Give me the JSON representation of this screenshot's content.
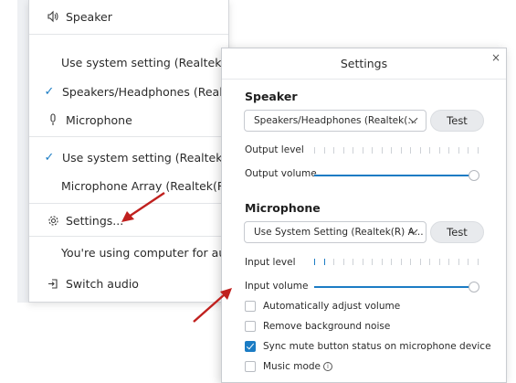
{
  "audio_menu": {
    "speaker_header": "Speaker",
    "use_system_setting_speaker": "Use system setting (Realtek(R)",
    "speakers_headphones": "Speakers/Headphones (Realtek",
    "microphone_header": "Microphone",
    "use_system_setting_mic": "Use system setting (Realtek(R)",
    "microphone_array": "Microphone Array (Realtek(R) A",
    "settings": "Settings...",
    "using_computer": "You're using computer for aud",
    "switch_audio": "Switch audio"
  },
  "settings": {
    "title": "Settings",
    "close": "×",
    "speaker_title": "Speaker",
    "speaker_device": "Speakers/Headphones (Realtek(...",
    "speaker_test": "Test",
    "output_level_label": "Output level",
    "output_level_ticks_on": 0,
    "output_volume_label": "Output volume",
    "output_volume": 1.0,
    "microphone_title": "Microphone",
    "mic_device": "Use System Setting (Realtek(R) A...",
    "mic_test": "Test",
    "input_level_label": "Input level",
    "input_level_ticks_on": 2,
    "input_volume_label": "Input volume",
    "input_volume": 1.0,
    "options": [
      {
        "label": "Automatically adjust volume",
        "checked": false
      },
      {
        "label": "Remove background noise",
        "checked": false
      },
      {
        "label": "Sync mute button status on microphone device",
        "checked": true
      },
      {
        "label": "Music mode",
        "checked": false
      }
    ]
  },
  "colors": {
    "accent": "#1b7cc4",
    "arrow": "#c0201e"
  },
  "icons": {
    "speaker": "speaker-icon",
    "microphone": "microphone-icon",
    "settings": "gear-icon",
    "switch_audio": "switch-audio-icon",
    "info": "info-icon"
  }
}
